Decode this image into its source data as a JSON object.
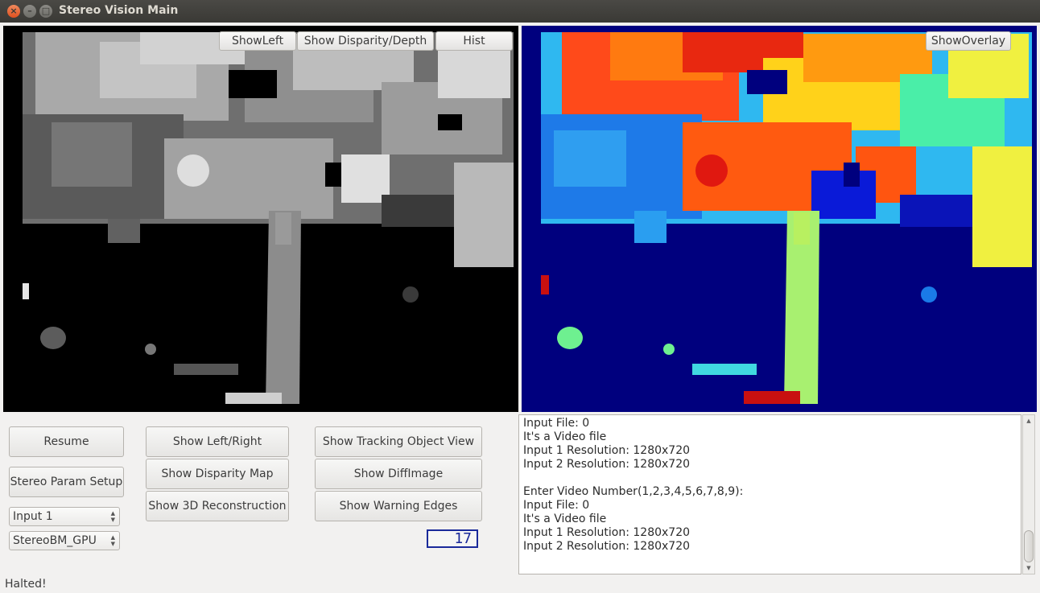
{
  "window": {
    "title": "Stereo Vision Main"
  },
  "left_pane": {
    "buttons": {
      "show_left": "ShowLeft",
      "show_disparity_depth": "Show Disparity/Depth",
      "hist": "Hist"
    }
  },
  "right_pane": {
    "buttons": {
      "show_overlay": "ShowOverlay"
    }
  },
  "controls": {
    "resume": "Resume",
    "stereo_param_setup": "Stereo Param Setup",
    "input_select": "Input 1",
    "algorithm_select": "StereoBM_GPU",
    "show_left_right": "Show Left/Right",
    "show_disparity_map": "Show Disparity Map",
    "show_3d_reconstruction": "Show 3D Reconstruction",
    "show_tracking_object_view": "Show Tracking Object View",
    "show_diff_image": "Show DiffImage",
    "show_warning_edges": "Show Warning Edges",
    "lcd_value": "17"
  },
  "log": {
    "lines": [
      "Input File: 0",
      "It's a Video file",
      "Input 1 Resolution: 1280x720",
      "Input 2 Resolution: 1280x720",
      "",
      "Enter Video Number(1,2,3,4,5,6,7,8,9):",
      "Input File: 0",
      "It's a Video file",
      "Input 1 Resolution: 1280x720",
      "Input 2 Resolution: 1280x720"
    ]
  },
  "status_bar": {
    "text": "Halted!"
  },
  "colors": {
    "titlebar": "#3c3b37",
    "jet_background": "#00007e",
    "lcd": "#1a2a9a"
  }
}
